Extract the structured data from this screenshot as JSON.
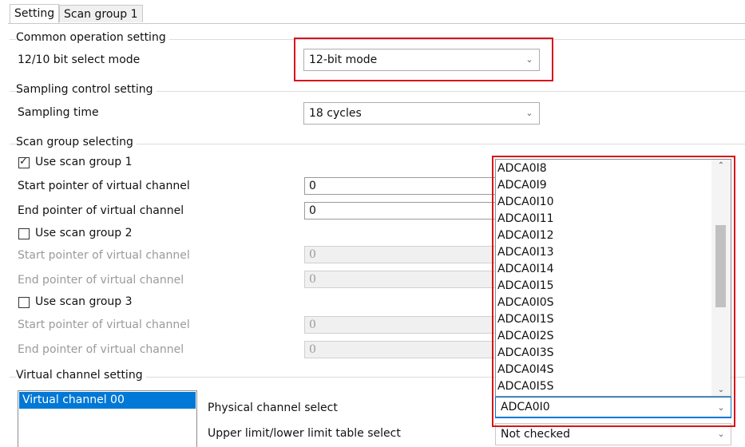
{
  "tabs": [
    {
      "label": "Setting",
      "active": true
    },
    {
      "label": "Scan group 1",
      "active": false
    }
  ],
  "common": {
    "title": "Common operation setting",
    "bit_mode_label": "12/10 bit select mode",
    "bit_mode_value": "12-bit mode"
  },
  "sampling": {
    "title": "Sampling control setting",
    "time_label": "Sampling time",
    "time_value": "18 cycles"
  },
  "scan": {
    "title": "Scan group selecting",
    "group1": {
      "label": "Use scan group 1",
      "checked": true,
      "start_label": "Start pointer of virtual channel",
      "start_value": "0",
      "end_label": "End pointer of virtual channel",
      "end_value": "0"
    },
    "group2": {
      "label": "Use scan group 2",
      "checked": false,
      "start_label": "Start pointer of virtual channel",
      "start_value": "0",
      "end_label": "End pointer of virtual channel",
      "end_value": "0"
    },
    "group3": {
      "label": "Use scan group 3",
      "checked": false,
      "start_label": "Start pointer of virtual channel",
      "start_value": "0",
      "end_label": "End pointer of virtual channel",
      "end_value": "0"
    }
  },
  "virtual": {
    "title": "Virtual channel setting",
    "selected_channel": "Virtual channel 00",
    "physical_label": "Physical channel select",
    "physical_value": "ADCA0I0",
    "limit_label": "Upper limit/lower limit table select",
    "limit_value": "Not checked"
  },
  "dropdown_options": [
    "ADCA0I8",
    "ADCA0I9",
    "ADCA0I10",
    "ADCA0I11",
    "ADCA0I12",
    "ADCA0I13",
    "ADCA0I14",
    "ADCA0I15",
    "ADCA0I0S",
    "ADCA0I1S",
    "ADCA0I2S",
    "ADCA0I3S",
    "ADCA0I4S",
    "ADCA0I5S"
  ],
  "icons": {
    "chevron": "chevron-down-icon",
    "check": "check-icon",
    "scroll_up": "scroll-up-arrow-icon",
    "scroll_down": "scroll-down-arrow-icon"
  },
  "colors": {
    "highlight_box": "#d8141a",
    "selection": "#0078d7",
    "disabled_text": "#9a9a9a"
  }
}
